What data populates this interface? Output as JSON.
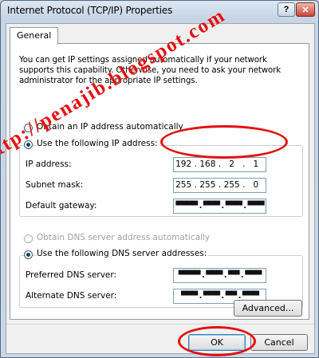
{
  "window": {
    "title": "Internet Protocol (TCP/IP) Properties",
    "help_glyph": "?",
    "close_glyph": "✕"
  },
  "tabs": [
    {
      "label": "General"
    }
  ],
  "intro_text": "You can get IP settings assigned automatically if your network supports this capability. Otherwise, you need to ask your network administrator for the appropriate IP settings.",
  "ip_mode": {
    "auto_label": "Obtain an IP address automatically",
    "manual_label": "Use the following IP address:",
    "selected": "manual"
  },
  "ip_fields": {
    "ip_label": "IP address:",
    "ip_value": [
      "192",
      "168",
      "2",
      "1"
    ],
    "subnet_label": "Subnet mask:",
    "subnet_value": [
      "255",
      "255",
      "255",
      "0"
    ],
    "gateway_label": "Default gateway:",
    "gateway_value": "▀▀▀▀ . ▀▀▀ . ▀▀▀ . ▀▀▀"
  },
  "dns_mode": {
    "auto_label": "Obtain DNS server address automatically",
    "manual_label": "Use the following DNS server addresses:",
    "selected": "manual"
  },
  "dns_fields": {
    "preferred_label": "Preferred DNS server:",
    "preferred_value": "▀▀▀▀ . ▀▀▀ . ▀▀ . ▀▀▀",
    "alternate_label": "Alternate DNS server:",
    "alternate_value": "▀▀▀ . ▀▀▀ . ▀▀ . ▀▀▀"
  },
  "buttons": {
    "advanced": "Advanced...",
    "ok": "OK",
    "cancel": "Cancel"
  },
  "watermark": "http://penajib.blogspot.com",
  "colors": {
    "annotation_red": "#e31010",
    "title_bar": "#c6d5e6",
    "field_border": "#7f9db9"
  }
}
